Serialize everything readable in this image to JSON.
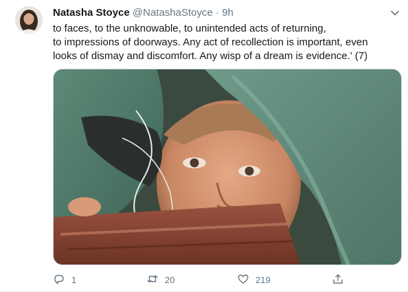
{
  "tweet": {
    "author_name": "Natasha Stoyce",
    "author_handle": "@NatashaStoyce",
    "separator": "·",
    "time": "9h",
    "text_lines": [
      "to faces, to the unknowable, to unintended acts of returning,",
      "to impressions of doorways. Any act of recollection is important, even",
      "looks of dismay and discomfort. Any wisp of a dream is evidence.' (7)"
    ]
  },
  "actions": {
    "reply_icon": "reply-icon",
    "reply_count": "1",
    "retweet_icon": "retweet-icon",
    "retweet_count": "20",
    "like_icon": "heart-icon",
    "like_count": "219",
    "share_icon": "share-icon"
  },
  "colors": {
    "text_primary": "#14171a",
    "text_secondary": "#657786",
    "border": "#ccd6dd"
  }
}
